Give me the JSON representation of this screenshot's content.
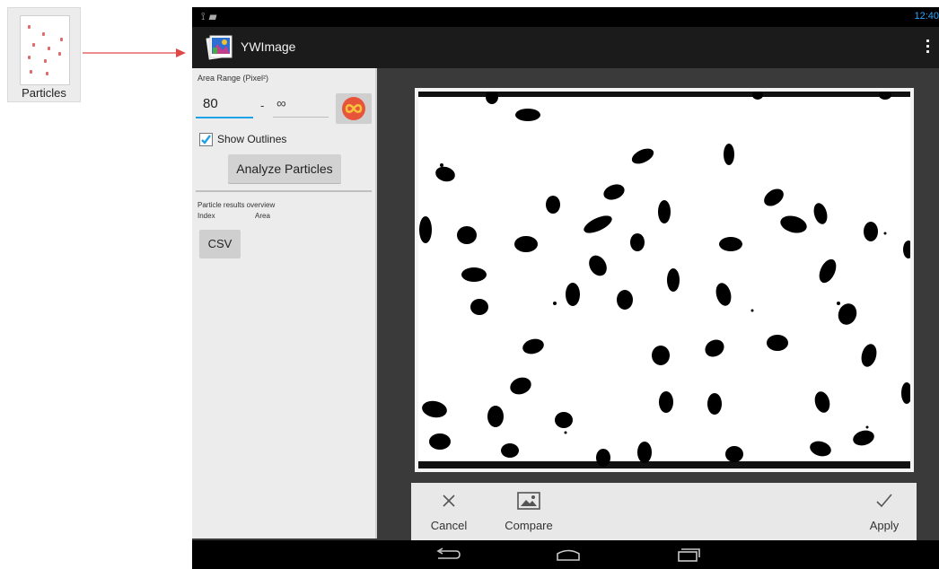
{
  "launcher": {
    "label": "Particles",
    "icon": "particles-thumbnail-icon"
  },
  "status_bar": {
    "time": "12:40",
    "icons": [
      "usb-icon",
      "android-debug-icon"
    ]
  },
  "action_bar": {
    "title": "YWImage",
    "app_icon": "ywimage-app-icon",
    "overflow_icon": "overflow-menu-icon"
  },
  "panel": {
    "area_range_label": "Area Range (Pixel²)",
    "min_value": "80",
    "separator": "-",
    "max_value": "∞",
    "infinity_button_icon": "infinity-icon",
    "show_outlines": {
      "label": "Show Outlines",
      "checked": true
    },
    "analyze_label": "Analyze Particles",
    "results": {
      "title": "Particle results overview",
      "columns": [
        "Index",
        "Area"
      ]
    },
    "csv_label": "CSV"
  },
  "bottom_bar": {
    "cancel": "Cancel",
    "compare": "Compare",
    "apply": "Apply"
  },
  "nav_bar": {
    "icons": [
      "back-icon",
      "home-icon",
      "recents-icon"
    ]
  },
  "colors": {
    "accent": "#1fa1e8",
    "infinity_button": "#e8543a",
    "time": "#2aa6ff"
  }
}
